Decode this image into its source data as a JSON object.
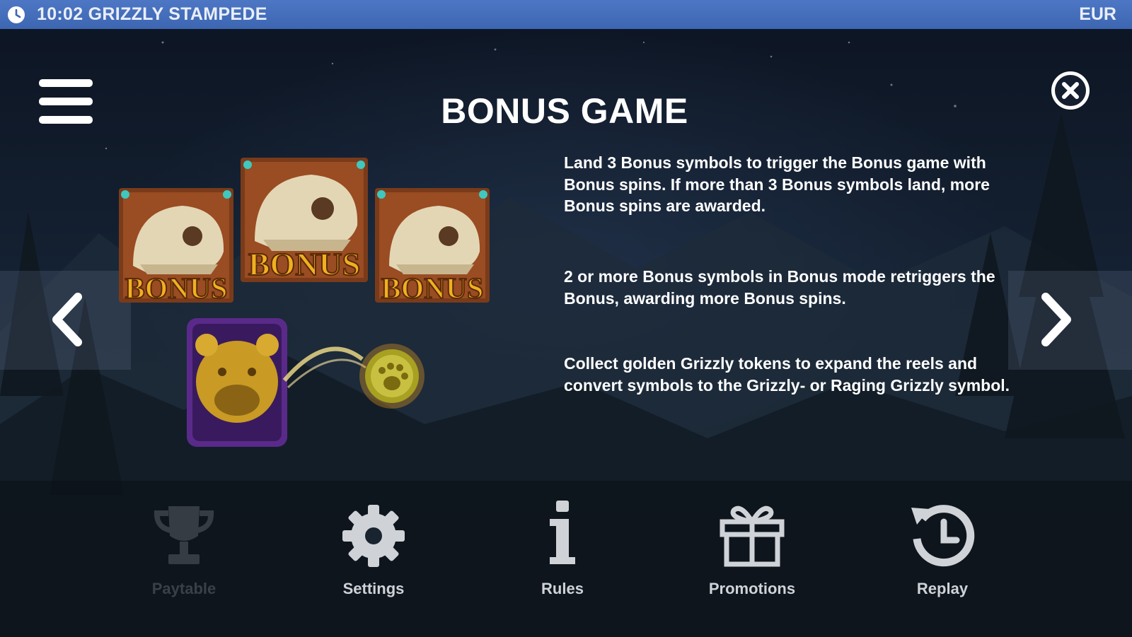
{
  "top_bar": {
    "time": "10:02",
    "game_name": "GRIZZLY STAMPEDE",
    "time_and_game": "10:02 GRIZZLY STAMPEDE",
    "currency": "EUR",
    "clock_icon": "clock-icon"
  },
  "page": {
    "title": "BONUS GAME",
    "menu_icon": "hamburger-menu-icon",
    "close_icon": "close-icon",
    "prev_icon": "chevron-left-icon",
    "next_icon": "chevron-right-icon"
  },
  "symbols": {
    "bonus_tile_label": "BONUS",
    "bonus_tile_count": 3,
    "bear_token_icon": "golden-grizzly-token-icon",
    "coin_icon": "paw-coin-icon"
  },
  "descriptions": [
    {
      "text": "Land 3 Bonus symbols to trigger the Bonus game with Bonus spins. If more than 3 Bonus symbols land, more Bonus spins are awarded."
    },
    {
      "text": "2 or more Bonus symbols in Bonus mode retriggers the Bonus, awarding more Bonus spins."
    },
    {
      "text": "Collect golden Grizzly tokens to expand the reels and convert symbols to the Grizzly- or Raging Grizzly symbol."
    }
  ],
  "footer_nav": [
    {
      "label": "Paytable",
      "icon": "trophy-icon",
      "state": "disabled"
    },
    {
      "label": "Settings",
      "icon": "gear-icon",
      "state": "normal"
    },
    {
      "label": "Rules",
      "icon": "info-icon",
      "state": "normal"
    },
    {
      "label": "Promotions",
      "icon": "gift-icon",
      "state": "normal"
    },
    {
      "label": "Replay",
      "icon": "replay-icon",
      "state": "normal"
    }
  ],
  "colors": {
    "top_bar": "#4570bc",
    "text": "#ffffff",
    "footer_label": "#cfd3d8",
    "disabled": "#3a4048",
    "bonus_gold": "#f0b020"
  }
}
